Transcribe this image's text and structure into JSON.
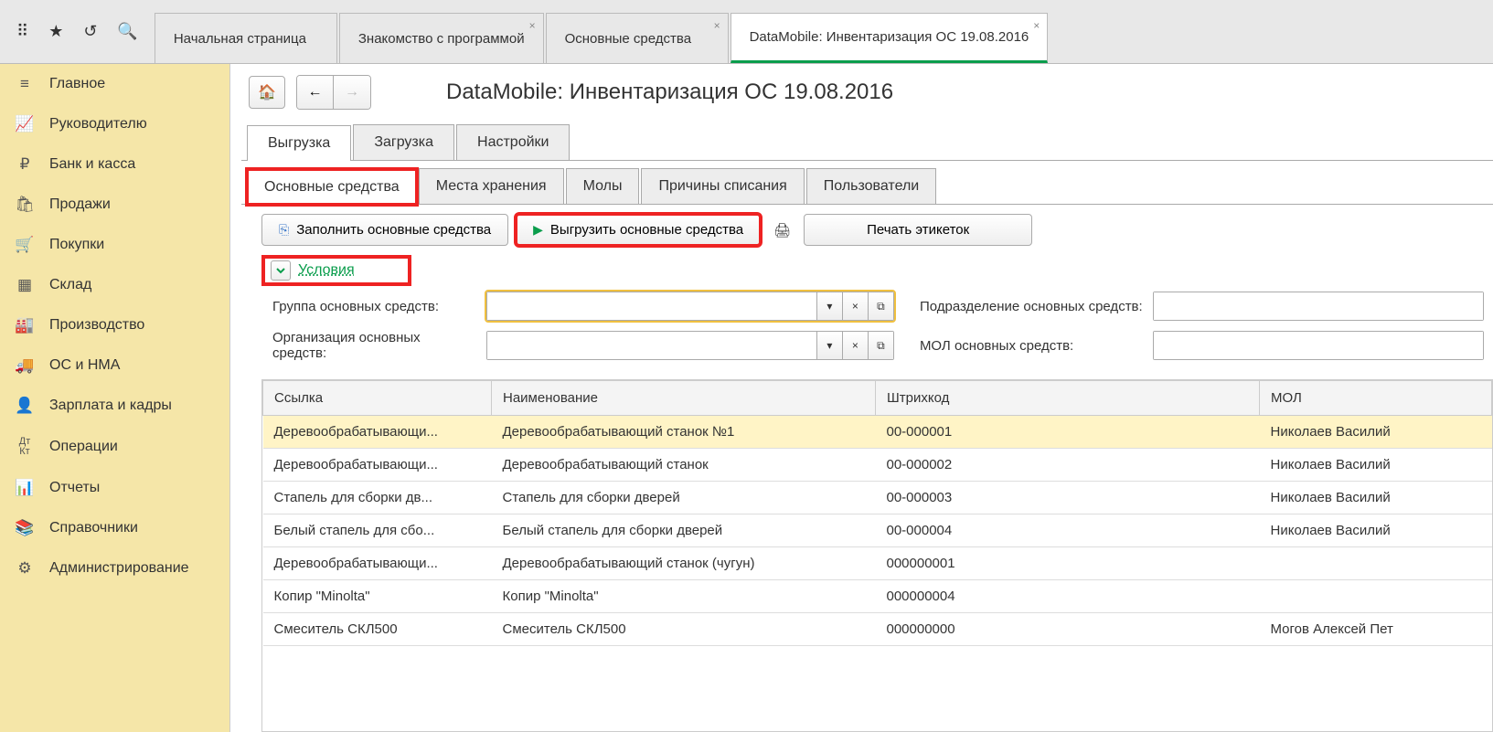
{
  "topbar": {
    "tabs": [
      {
        "label": "Начальная страница",
        "closable": false
      },
      {
        "label": "Знакомство с программой",
        "closable": true
      },
      {
        "label": "Основные средства",
        "closable": true
      },
      {
        "label": "DataMobile: Инвентаризация ОС 19.08.2016",
        "closable": true,
        "active": true
      }
    ]
  },
  "sidebar": [
    {
      "label": "Главное",
      "icon": "menu"
    },
    {
      "label": "Руководителю",
      "icon": "chart"
    },
    {
      "label": "Банк и касса",
      "icon": "ruble"
    },
    {
      "label": "Продажи",
      "icon": "bag"
    },
    {
      "label": "Покупки",
      "icon": "cart"
    },
    {
      "label": "Склад",
      "icon": "boxes"
    },
    {
      "label": "Производство",
      "icon": "factory"
    },
    {
      "label": "ОС и НМА",
      "icon": "truck"
    },
    {
      "label": "Зарплата и кадры",
      "icon": "person"
    },
    {
      "label": "Операции",
      "icon": "dtkt"
    },
    {
      "label": "Отчеты",
      "icon": "bars"
    },
    {
      "label": "Справочники",
      "icon": "books"
    },
    {
      "label": "Администрирование",
      "icon": "gear"
    }
  ],
  "page": {
    "title": "DataMobile: Инвентаризация ОС 19.08.2016"
  },
  "mainTabs": [
    "Выгрузка",
    "Загрузка",
    "Настройки"
  ],
  "subTabs": [
    "Основные средства",
    "Места хранения",
    "Молы",
    "Причины списания",
    "Пользователи"
  ],
  "actions": {
    "fill": "Заполнить основные средства",
    "export": "Выгрузить основные средства",
    "print": "Печать этикеток"
  },
  "conditions": {
    "label": "Условия"
  },
  "filters": {
    "group_label": "Группа основных средств:",
    "group_value": "",
    "org_label": "Организация основных средств:",
    "org_value": "",
    "dept_label": "Подразделение основных средств:",
    "mol_label": "МОЛ основных средств:"
  },
  "columns": {
    "link": "Ссылка",
    "name": "Наименование",
    "code": "Штрихкод",
    "mol": "МОЛ"
  },
  "rows": [
    {
      "link": "Деревообрабатывающи...",
      "name": "Деревообрабатывающий станок №1",
      "code": "00-000001",
      "mol": "Николаев Василий "
    },
    {
      "link": "Деревообрабатывающи...",
      "name": "Деревообрабатывающий станок",
      "code": "00-000002",
      "mol": "Николаев Василий "
    },
    {
      "link": "Стапель для сборки дв...",
      "name": "Стапель для сборки дверей",
      "code": "00-000003",
      "mol": "Николаев Василий "
    },
    {
      "link": "Белый стапель для сбо...",
      "name": "Белый стапель для сборки дверей",
      "code": "00-000004",
      "mol": "Николаев Василий "
    },
    {
      "link": "Деревообрабатывающи...",
      "name": "Деревообрабатывающий станок (чугун)",
      "code": "000000001",
      "mol": ""
    },
    {
      "link": "Копир \"Minolta\"",
      "name": "Копир \"Minolta\"",
      "code": "000000004",
      "mol": ""
    },
    {
      "link": "Смеситель СКЛ500",
      "name": "Смеситель СКЛ500",
      "code": "000000000",
      "mol": "Могов Алексей Пет"
    }
  ]
}
